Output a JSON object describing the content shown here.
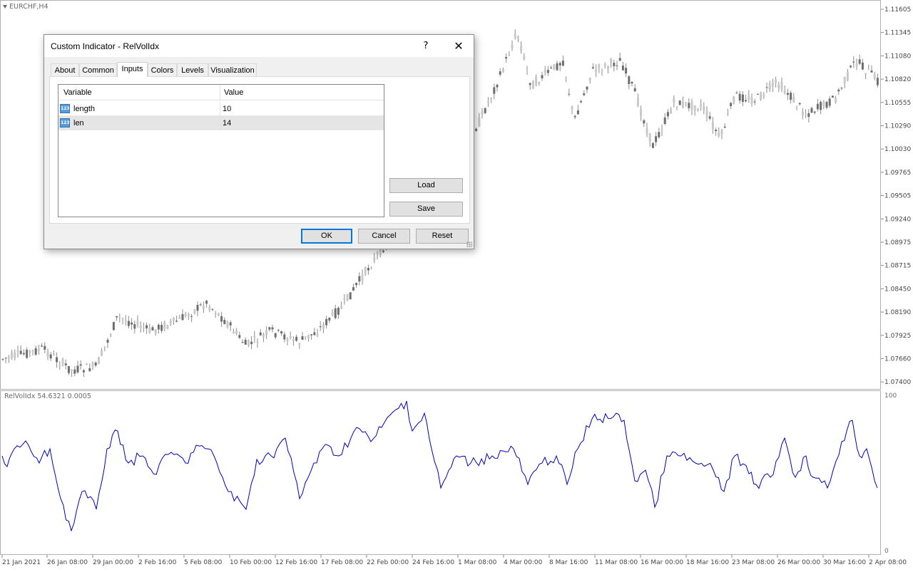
{
  "chart": {
    "symbol": "EURCHF,H4",
    "price_ticks": [
      "1.11605",
      "1.11345",
      "1.11080",
      "1.10820",
      "1.10555",
      "1.10290",
      "1.10030",
      "1.09765",
      "1.09505",
      "1.09240",
      "1.08975",
      "1.08715",
      "1.08450",
      "1.08190",
      "1.07925",
      "1.07660",
      "1.07400"
    ],
    "time_ticks": [
      "21 Jan 2021",
      "26 Jan 08:00",
      "29 Jan 00:00",
      "2 Feb 16:00",
      "5 Feb 08:00",
      "10 Feb 00:00",
      "12 Feb 16:00",
      "17 Feb 08:00",
      "22 Feb 00:00",
      "24 Feb 16:00",
      "1 Mar 08:00",
      "4 Mar 00:00",
      "8 Mar 16:00",
      "11 Mar 08:00",
      "16 Mar 00:00",
      "18 Mar 16:00",
      "23 Mar 08:00",
      "26 Mar 00:00",
      "30 Mar 16:00",
      "2 Apr 08:00"
    ]
  },
  "indicator": {
    "label": "RelVolIdx 54.6321 0.0005",
    "scale_max": "100",
    "scale_min": "0",
    "line_color": "#0000bb"
  },
  "dialog": {
    "title": "Custom Indicator - RelVolIdx",
    "help": "?",
    "close": "✕",
    "tabs": [
      "About",
      "Common",
      "Inputs",
      "Colors",
      "Levels",
      "Visualization"
    ],
    "active_tab": "Inputs",
    "columns": [
      "Variable",
      "Value"
    ],
    "rows": [
      {
        "icon": "123",
        "variable": "length",
        "value": "10"
      },
      {
        "icon": "123",
        "variable": "len",
        "value": "14"
      }
    ],
    "buttons": {
      "load": "Load",
      "save": "Save",
      "ok": "OK",
      "cancel": "Cancel",
      "reset": "Reset"
    }
  }
}
